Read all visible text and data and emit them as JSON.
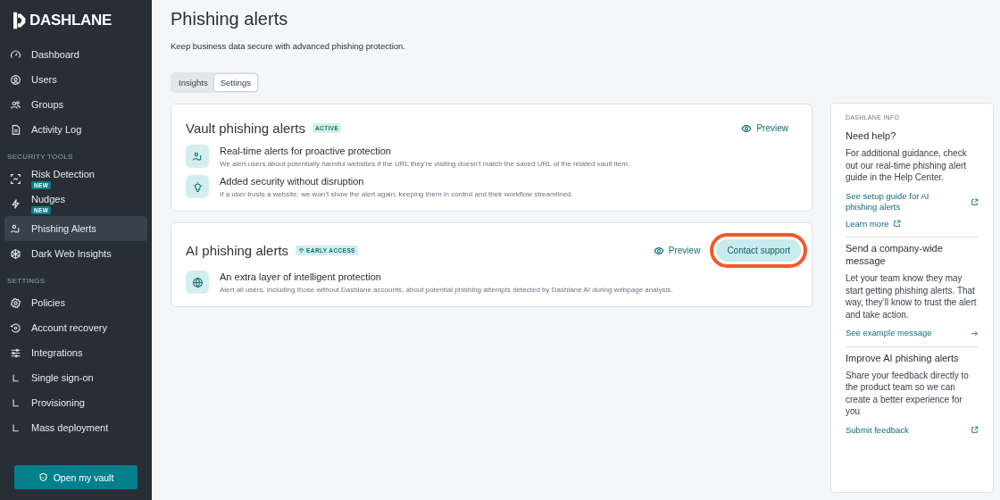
{
  "sidebar": {
    "logo": "DASHLANE",
    "sections": [
      {
        "items": [
          {
            "label": "Dashboard",
            "kind": "main",
            "selected": false
          },
          {
            "label": "Users",
            "kind": "main",
            "selected": false
          },
          {
            "label": "Groups",
            "kind": "main",
            "selected": false
          },
          {
            "label": "Activity Log",
            "kind": "main",
            "selected": false
          }
        ]
      },
      {
        "heading": "SECURITY TOOLS",
        "items": [
          {
            "label": "Risk Detection",
            "kind": "main",
            "badge": "NEW",
            "selected": false
          },
          {
            "label": "Nudges",
            "kind": "main",
            "badge": "NEW",
            "selected": false
          },
          {
            "label": "Phishing Alerts",
            "kind": "main",
            "selected": true
          },
          {
            "label": "Dark Web Insights",
            "kind": "main",
            "selected": false
          }
        ]
      },
      {
        "heading": "SETTINGS",
        "items": [
          {
            "label": "Policies",
            "kind": "main",
            "selected": false
          },
          {
            "label": "Account recovery",
            "kind": "main",
            "selected": false
          },
          {
            "label": "Integrations",
            "kind": "main",
            "selected": false
          },
          {
            "label": "Single sign-on",
            "kind": "sub",
            "selected": false
          },
          {
            "label": "Provisioning",
            "kind": "sub",
            "selected": false
          },
          {
            "label": "Mass deployment",
            "kind": "sub",
            "selected": false
          }
        ]
      }
    ],
    "button": "Open my vault"
  },
  "page": {
    "title": "Phishing alerts",
    "subtitle": "Keep business data secure with advanced phishing protection.",
    "tabs": [
      {
        "label": "Insights",
        "selected": false
      },
      {
        "label": "Settings",
        "selected": true
      }
    ]
  },
  "cards": [
    {
      "title": "Vault phishing alerts",
      "badge": {
        "label": "ACTIVE",
        "kind": "active"
      },
      "preview": "Preview",
      "features": [
        {
          "title": "Real-time alerts for proactive protection",
          "text": "We alert users about potentially harmful websites if the URL they’re visiting doesn’t match the saved URL of the related vault item."
        },
        {
          "title": "Added security without disruption",
          "text": "If a user trusts a website, we won’t show the alert again, keeping them in control and their workflow streamlined."
        }
      ]
    },
    {
      "title": "AI phishing alerts",
      "badge": {
        "label": "EARLY ACCESS",
        "kind": "early"
      },
      "preview": "Preview",
      "action": {
        "label": "Contact support",
        "highlighted": true
      },
      "features": [
        {
          "title": "An extra layer of intelligent protection",
          "text": "Alert all users, including those without Dashlane accounts, about potential phishing attempts detected by Dashlane AI during webpage analysis."
        }
      ]
    }
  ],
  "info": {
    "heading": "DASHLANE INFO",
    "sections": [
      {
        "title": "Need help?",
        "text": "For additional guidance, check out our real-time phishing alert guide in the Help Center.",
        "links": [
          {
            "label": "See setup guide for AI phishing alerts",
            "kind": "external"
          },
          {
            "label": "Learn more",
            "kind": "external"
          }
        ]
      },
      {
        "title": "Send a company-wide message",
        "text": "Let your team know they may start getting phishing alerts. That way, they’ll know to trust the alert and take action.",
        "links": [
          {
            "label": "See example message",
            "kind": "arrow"
          }
        ]
      },
      {
        "title": "Improve AI phishing alerts",
        "text": "Share your feedback directly to the product team so we can create a better experience for you",
        "links": [
          {
            "label": "Submit feedback",
            "kind": "external"
          }
        ]
      }
    ]
  }
}
